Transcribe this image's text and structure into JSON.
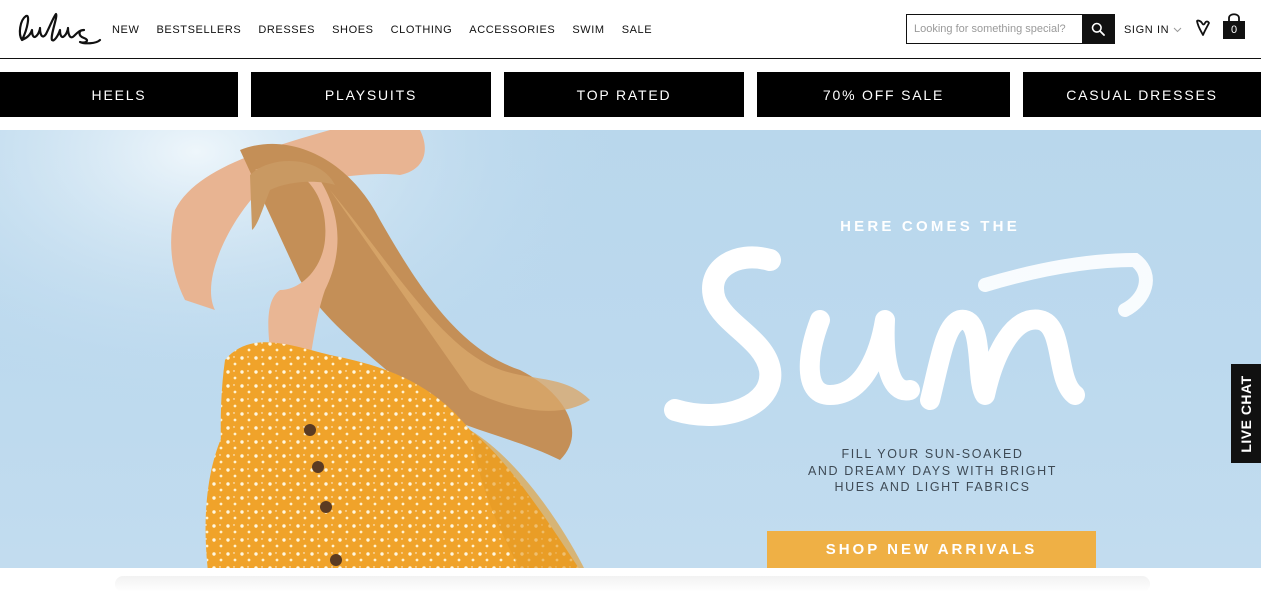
{
  "header": {
    "logo_text": "Lulus",
    "nav": [
      "NEW",
      "BESTSELLERS",
      "DRESSES",
      "SHOES",
      "CLOTHING",
      "ACCESSORIES",
      "SWIM",
      "SALE"
    ],
    "search": {
      "placeholder": "Looking for something special?",
      "icon": "search-icon"
    },
    "sign_in": "SIGN IN",
    "wishlist_icon": "heart-icon",
    "bag_count": "0"
  },
  "categories": [
    "HEELS",
    "PLAYSUITS",
    "TOP RATED",
    "70% OFF SALE",
    "CASUAL DRESSES"
  ],
  "hero": {
    "kicker": "HERE COMES THE",
    "script": "Sun",
    "copy": [
      "FILL YOUR SUN-SOAKED",
      "AND DREAMY DAYS WITH BRIGHT",
      "HUES AND LIGHT FABRICS"
    ],
    "cta": "SHOP NEW ARRIVALS",
    "colors": {
      "sky": "#bcd9ee",
      "dress": "#f0a32a",
      "cta": "#efb045"
    }
  },
  "live_chat": "LIVE CHAT"
}
